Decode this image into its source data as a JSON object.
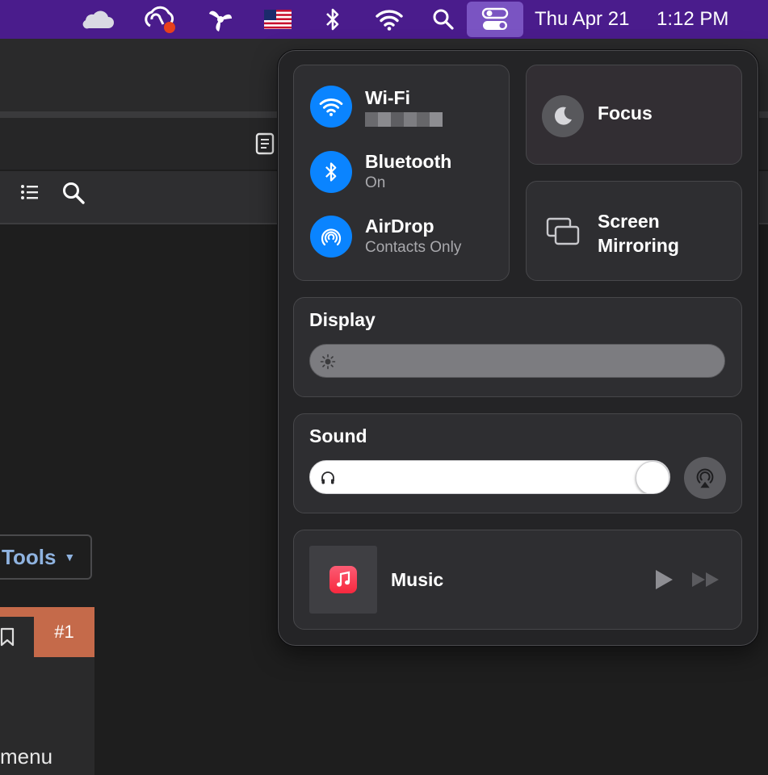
{
  "menubar": {
    "icons": [
      "onedrive-icon",
      "creative-cloud-icon",
      "splashtop-icon",
      "us-flag-icon",
      "bluetooth-icon",
      "wifi-icon",
      "spotlight-search-icon",
      "control-center-icon"
    ],
    "date": "Thu Apr 21",
    "time": "1:12 PM",
    "colors": {
      "background": "#4a1c8c",
      "active_item": "#7a54c2",
      "badge": "#e8401c"
    }
  },
  "background_app": {
    "tools_label": "Tools",
    "badge_label": "#1",
    "menu_text": "menu",
    "colors": {
      "badge": "#c56a4a",
      "link": "#8fb3e0"
    }
  },
  "control_center": {
    "connectivity": {
      "wifi": {
        "title": "Wi-Fi",
        "subtitle": ""
      },
      "bluetooth": {
        "title": "Bluetooth",
        "subtitle": "On"
      },
      "airdrop": {
        "title": "AirDrop",
        "subtitle": "Contacts Only"
      }
    },
    "focus": {
      "label": "Focus"
    },
    "screen_mirroring": {
      "label": "Screen\nMirroring"
    },
    "display": {
      "heading": "Display",
      "brightness": 0
    },
    "sound": {
      "heading": "Sound",
      "volume": 1.0
    },
    "now_playing": {
      "app": "Music"
    },
    "colors": {
      "accent": "#0a84ff",
      "panel": "#242426",
      "tile": "#2e2e31"
    }
  }
}
